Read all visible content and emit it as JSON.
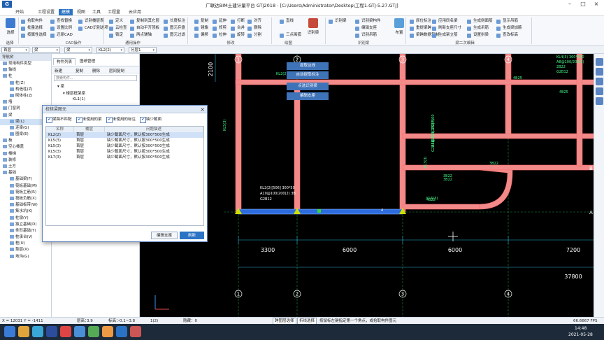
{
  "app": {
    "title": "广联达BIM土建计量平台 GTJ2018 - [C:\\Users\\Administrator\\Desktop\\工程1.GTJ-5.27.GTJ]",
    "logo": "G"
  },
  "menus": [
    "开始",
    "工程设置",
    "建模",
    "视图",
    "工具",
    "工程量",
    "云应用"
  ],
  "active_menu": "建模",
  "ribbon": {
    "big": [
      {
        "label": "选择",
        "color": "#3d7bd1"
      },
      {
        "label": "识别梁",
        "color": "#c64b3b"
      },
      {
        "label": "布置",
        "color": "#5aa0d8"
      }
    ],
    "col1": [
      "拾取构件",
      "批量选择",
      "按属性选择"
    ],
    "col2": [
      "查找替换",
      "设置比例",
      "还原CAD"
    ],
    "col3": [
      "识别楼层表",
      "CAD识别选项",
      ""
    ],
    "col4": [
      "定义",
      "云检查",
      "锁定"
    ],
    "col5": [
      "复制到其它层",
      "自动平齐顶板",
      "两点辅轴"
    ],
    "col6": [
      "长度标注",
      "图元存盘",
      "图元过滤"
    ],
    "col7": [
      "复制",
      "镜像",
      "偏移"
    ],
    "col8": [
      "延伸",
      "修剪",
      "拉伸"
    ],
    "col9": [
      "打断",
      "合并",
      "旋转"
    ],
    "col10": [
      "对齐",
      "删除",
      "分割"
    ],
    "col11": [
      "直线",
      "",
      "三点画弧"
    ],
    "col12": [
      "识别梁",
      "",
      ""
    ],
    "col13": [
      "识别梁构件",
      "编辑支座",
      "识别吊筋"
    ],
    "col14": [
      "原位标注",
      "重提梁跨",
      "梁跨数据复制"
    ],
    "col15": [
      "应用同名梁",
      "刷新支座尺寸",
      "生成架立筋"
    ],
    "col16": [
      "生成侧面筋",
      "生成吊筋",
      "设置拱梁"
    ],
    "col17": [
      "显示吊筋",
      "生成梁加腋",
      "查改标高"
    ],
    "groups": [
      "选择",
      "CAD操作",
      "通用操作",
      "修改",
      "绘图",
      "识别梁",
      "梁二次编辑"
    ],
    "group_mid": "识别梁"
  },
  "selectors": [
    "首层",
    "梁",
    "梁",
    "KL2(2)",
    "分层1"
  ],
  "nav": {
    "header": "导航树",
    "items": [
      {
        "label": "常用构件类型",
        "indent": 0
      },
      {
        "label": "轴线",
        "indent": 0
      },
      {
        "label": "柱",
        "indent": 0
      },
      {
        "label": "柱(Z)",
        "indent": 1
      },
      {
        "label": "构造柱(Z)",
        "indent": 1
      },
      {
        "label": "砌体柱(Z)",
        "indent": 1
      },
      {
        "label": "墙",
        "indent": 0
      },
      {
        "label": "门窗洞",
        "indent": 0
      },
      {
        "label": "梁",
        "indent": 0
      },
      {
        "label": "梁(L)",
        "indent": 1,
        "selected": true
      },
      {
        "label": "连梁(G)",
        "indent": 1
      },
      {
        "label": "圈梁(E)",
        "indent": 1
      },
      {
        "label": "板",
        "indent": 0
      },
      {
        "label": "空心楼盖",
        "indent": 0
      },
      {
        "label": "楼梯",
        "indent": 0
      },
      {
        "label": "装修",
        "indent": 0
      },
      {
        "label": "土方",
        "indent": 0
      },
      {
        "label": "基础",
        "indent": 0
      },
      {
        "label": "基础梁(F)",
        "indent": 1
      },
      {
        "label": "筏板基础(M)",
        "indent": 1
      },
      {
        "label": "筏板主筋(R)",
        "indent": 1
      },
      {
        "label": "筏板负筋(X)",
        "indent": 1
      },
      {
        "label": "基础板带(W)",
        "indent": 1
      },
      {
        "label": "集水坑(K)",
        "indent": 1
      },
      {
        "label": "柱墩(Y)",
        "indent": 1
      },
      {
        "label": "独立基础(D)",
        "indent": 1
      },
      {
        "label": "条形基础(T)",
        "indent": 1
      },
      {
        "label": "桩承台(V)",
        "indent": 1
      },
      {
        "label": "桩(U)",
        "indent": 1
      },
      {
        "label": "垫层(X)",
        "indent": 1
      },
      {
        "label": "地沟(G)",
        "indent": 1
      }
    ]
  },
  "plist": {
    "tabs": [
      "构件列表",
      "图纸管理"
    ],
    "toolbar": [
      "新建",
      "复制",
      "删除",
      "层间复制"
    ],
    "search_placeholder": "搜索构件...",
    "tree": [
      "梁",
      "楼层框架梁",
      "KL1(1)"
    ]
  },
  "float_buttons": [
    "提取边线",
    "自动提取标注",
    "点选识别梁",
    "编辑支座"
  ],
  "dialog": {
    "title": "校核梁图元",
    "checks": [
      "梁跨不匹配",
      "未使用的梁",
      "未使用的标注",
      "缺少截面"
    ],
    "columns": [
      "名称",
      "楼层",
      "问题描述"
    ],
    "rows": [
      {
        "name": "KL2(2)",
        "floor": "首层",
        "desc": "缺少截面尺寸，默认按300*500生成",
        "hl": true
      },
      {
        "name": "KL5(3)",
        "floor": "首层",
        "desc": "缺少截面尺寸，默认按300*500生成"
      },
      {
        "name": "KL5(3)",
        "floor": "首层",
        "desc": "缺少截面尺寸，默认按300*500生成"
      },
      {
        "name": "KL5(3)",
        "floor": "首层",
        "desc": "缺少截面尺寸，默认按300*500生成"
      },
      {
        "name": "KL7(3)",
        "floor": "首层",
        "desc": "缺少截面尺寸，默认按300*500生成"
      }
    ],
    "btn_edit": "编辑支座",
    "btn_refresh": "刷新"
  },
  "canvas": {
    "axis_top": [
      "1",
      "2",
      "3",
      "4"
    ],
    "axis_bottom": [
      "1",
      "2",
      "3",
      "4"
    ],
    "dims_row1": [
      "3300",
      "6000",
      "6000",
      "7200"
    ],
    "dim_total": "37800",
    "dim_side": "2100",
    "beam_labels": [
      "KL5(3)",
      "KL2(2)",
      "KL3(3)",
      "4B25",
      "4B25",
      "3B22",
      "3B22",
      "3B22",
      "4B22",
      "KL6(3)",
      "4"
    ],
    "annot_block": [
      "KL2(2)[506] 300*50",
      "A10@100/200(2) 3B",
      "G2B12"
    ],
    "annot_right": [
      "KL4(3) 300*500",
      "A8@100/200(2)",
      "2B22",
      "G2B12"
    ],
    "annot_mid": [
      "KL3(3) 250*500",
      "A8@100/200(2)",
      "G2B12"
    ],
    "axis_right": [
      "A",
      "B"
    ]
  },
  "status": {
    "coords": "X = 12031 Y = -1411",
    "floor_h_label": "层高：",
    "floor_h": "3.9",
    "elev_label": "标高：",
    "elev": "-0.1~3.8",
    "count": "1(2)",
    "hidden": "隐藏：0",
    "mode1": "跨图层选择",
    "mode2": "折线选择",
    "hint": "按鼠标左键指定第一个角点，或拾取构件图元",
    "fps": "66.6667 FPS"
  },
  "taskbar": {
    "time": "14:48",
    "date": "2021-05-28"
  },
  "colors": {
    "accent": "#2b73c4",
    "beam": "#ff8d8d",
    "beam_blue": "#2d6cdf",
    "support": "#cde000"
  }
}
